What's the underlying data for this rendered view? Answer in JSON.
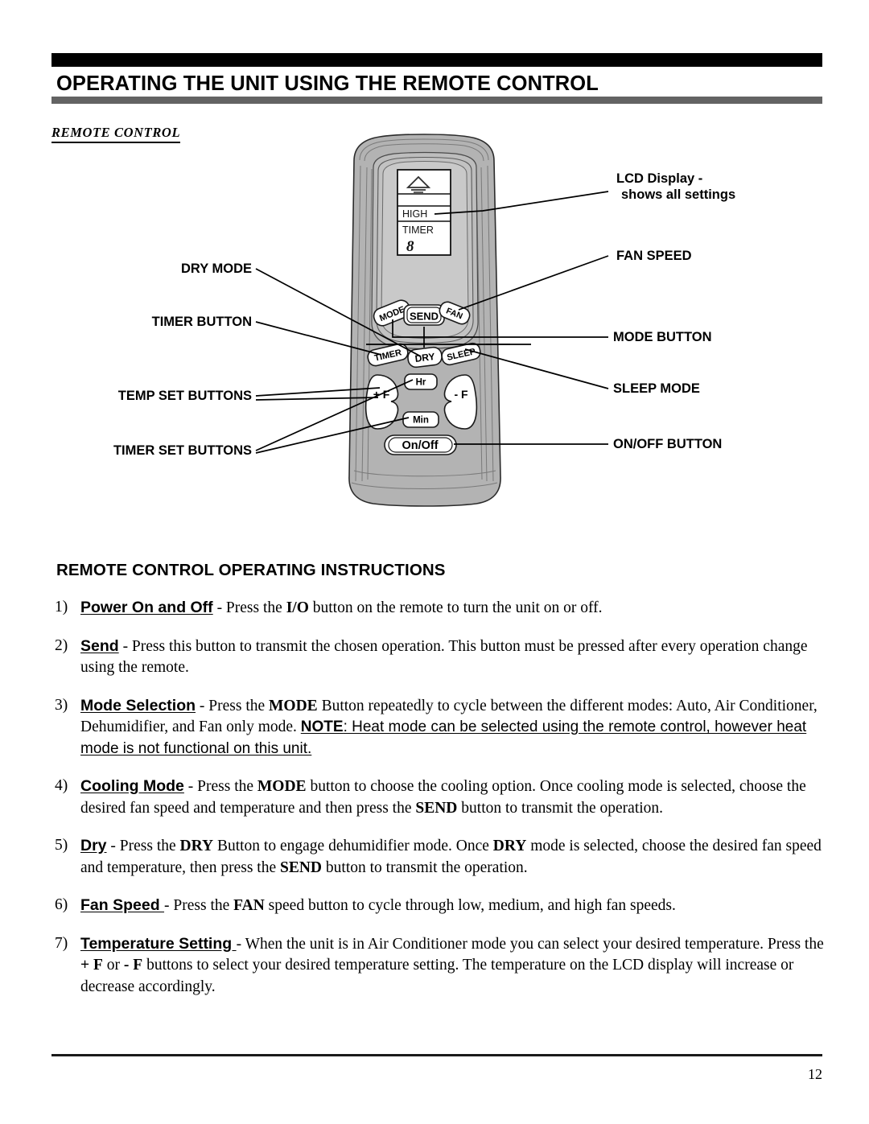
{
  "header": {
    "title": "OPERATING THE UNIT USING THE REMOTE CONTROL",
    "black_bar_color": "#000000",
    "gray_bar_color": "#636363"
  },
  "section": {
    "caption": "REMOTE CONTROL"
  },
  "remote": {
    "lcd": {
      "fan_icon": "fan-signal-icon",
      "row_blank": "",
      "fan_speed": "HIGH",
      "timer_label": "TIMER",
      "digit": "8"
    },
    "buttons": {
      "mode": "MODE",
      "send": "SEND",
      "fan": "FAN",
      "timer": "TIMER",
      "dry": "DRY",
      "sleep": "SLEEP",
      "temp_up": "+ F",
      "temp_down": "- F",
      "hour": "Hr",
      "minute": "Min",
      "on_off": "On/Off"
    },
    "body_color": "#b3b3b3",
    "bezel_color": "#c6c6c6",
    "button_color": "#ffffff"
  },
  "callouts": {
    "left": [
      {
        "label": "DRY MODE"
      },
      {
        "label": "TIMER BUTTON"
      },
      {
        "label": "TEMP SET BUTTONS"
      },
      {
        "label": "TIMER SET BUTTONS"
      }
    ],
    "right": [
      {
        "line1": "LCD Display -",
        "line2": "shows all settings"
      },
      {
        "label": "FAN SPEED"
      },
      {
        "label": "MODE BUTTON"
      },
      {
        "label": "SLEEP MODE"
      },
      {
        "label": "ON/OFF BUTTON"
      }
    ]
  },
  "instructions": {
    "heading": "REMOTE CONTROL OPERATING INSTRUCTIONS",
    "items": [
      {
        "num": "1)",
        "lead": "Power On and Off",
        "body_a": " - Press the ",
        "bold_a": "I/O",
        "body_b": " button on the remote to turn the unit on or off."
      },
      {
        "num": "2)",
        "lead": "Send",
        "body_a": " - Press this button to transmit the chosen operation. This button must be pressed after every operation change using the remote."
      },
      {
        "num": "3)",
        "lead": "Mode Selection",
        "body_a": " - Press the ",
        "bold_a": "MODE",
        "body_b": " Button repeatedly to cycle between the different modes: Auto, Air Conditioner, Dehumidifier,  and Fan only mode. ",
        "note_label": "NOTE",
        "note_body": ": Heat mode can be selected using the remote control, however heat mode is not functional on this unit."
      },
      {
        "num": "4)",
        "lead": "Cooling Mode",
        "body_a": " - Press the ",
        "bold_a": "MODE",
        "body_b": " button to choose the cooling option. Once cooling mode is selected, choose the desired fan speed and temperature and then press the ",
        "bold_b": "SEND",
        "body_c": " button to transmit the operation."
      },
      {
        "num": "5)",
        "lead": "Dry",
        "body_a": " - Press the ",
        "bold_a": "DRY",
        "body_b": " Button to engage dehumidifier mode. Once ",
        "bold_b": "DRY",
        "body_c": " mode is selected, choose the desired fan speed and temperature, then press the ",
        "bold_c": "SEND",
        "body_d": " button to transmit the operation."
      },
      {
        "num": "6)",
        "lead": "Fan Speed ",
        "body_a": "- Press the ",
        "bold_a": "FAN",
        "body_b": " speed button to cycle through low, medium, and high fan speeds."
      },
      {
        "num": "7)",
        "lead": "Temperature Setting ",
        "body_a": "- When the unit is in Air Conditioner mode you can select your desired temperature. Press the ",
        "bold_a": "+ F",
        "body_b": " or ",
        "bold_b": "- F",
        "body_c": " buttons to select your desired temperature setting. The temperature on the LCD display will increase or decrease accordingly."
      }
    ]
  },
  "footer": {
    "page_number": "12"
  }
}
